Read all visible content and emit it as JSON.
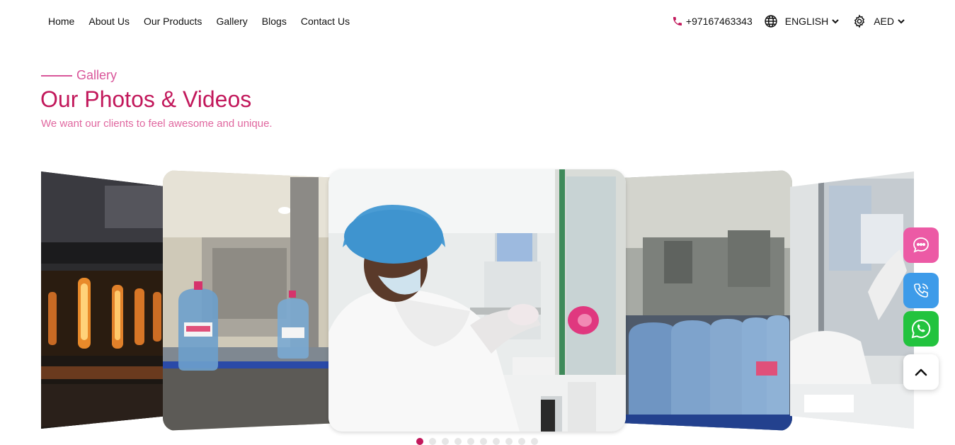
{
  "nav": {
    "links": [
      "Home",
      "About Us",
      "Our Products",
      "Gallery",
      "Blogs",
      "Contact Us"
    ],
    "phone": "+97167463343",
    "language": "ENGLISH",
    "currency": "AED",
    "icons": {
      "phone": "phone-icon",
      "language": "globe-icon",
      "currency": "gear-icon",
      "dropdown": "chevron-down-icon"
    }
  },
  "section": {
    "eyebrow": "Gallery",
    "title": "Our Photos & Videos",
    "subtitle": "We want our clients to feel awesome and unique."
  },
  "carousel": {
    "slide_count": 5,
    "active_dot": 0,
    "dot_count": 10
  },
  "floating_buttons": [
    {
      "name": "chat-button",
      "icon": "chat-bubble-icon",
      "color": "#ec5aa5"
    },
    {
      "name": "call-button",
      "icon": "phone-ring-icon",
      "color": "#3d9be9"
    },
    {
      "name": "whatsapp-button",
      "icon": "whatsapp-icon",
      "color": "#22c33e"
    },
    {
      "name": "scroll-top-button",
      "icon": "chevron-up-icon",
      "color": "#ffffff"
    }
  ],
  "colors": {
    "brand": "#c2185b",
    "brand_light": "#e0679f"
  }
}
